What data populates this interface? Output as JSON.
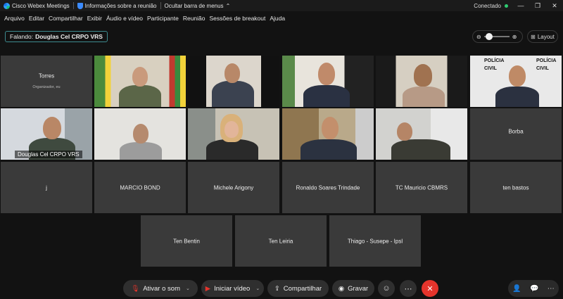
{
  "titlebar": {
    "app_name": "Cisco Webex Meetings",
    "meeting_info": "Informações sobre a reunião",
    "hide_menu": "Ocultar barra de menus",
    "status": "Conectado"
  },
  "menu": [
    "Arquivo",
    "Editar",
    "Compartilhar",
    "Exibir",
    "Áudio e vídeo",
    "Participante",
    "Reunião",
    "Sessões de breakout",
    "Ajuda"
  ],
  "speaker": {
    "prefix": "Falando:",
    "name": "Douglas Cel CRPO VRS"
  },
  "layout_label": "Layout",
  "tiles": {
    "torres": {
      "name": "Torres",
      "sub": "Organizador, eu"
    },
    "douglas": {
      "name": "Douglas Cel CRPO VRS"
    },
    "borba": {
      "name": "Borba"
    },
    "j": {
      "name": "j"
    },
    "marcio": {
      "name": "MARCIO BOND"
    },
    "michele": {
      "name": "Michele Arigony"
    },
    "ronaldo": {
      "name": "Ronaldo Soares Trindade"
    },
    "tc": {
      "name": "TC Mauricio CBMRS"
    },
    "bastos": {
      "name": "ten bastos"
    },
    "bentin": {
      "name": "Ten Bentin"
    },
    "leiria": {
      "name": "Ten Leiria"
    },
    "thiago": {
      "name": "Thiago - Susepe - Ipsl"
    }
  },
  "video_text": {
    "policia": "POLÍCIA",
    "civil": "CIVIL"
  },
  "toolbar": {
    "audio": "Ativar o som",
    "video": "Iniciar vídeo",
    "share": "Compartilhar",
    "record": "Gravar"
  },
  "colors": {
    "accent": "#3bb7ea",
    "end_call": "#e5342c",
    "mute_red": "#e5342c",
    "connected": "#2ecc71"
  }
}
